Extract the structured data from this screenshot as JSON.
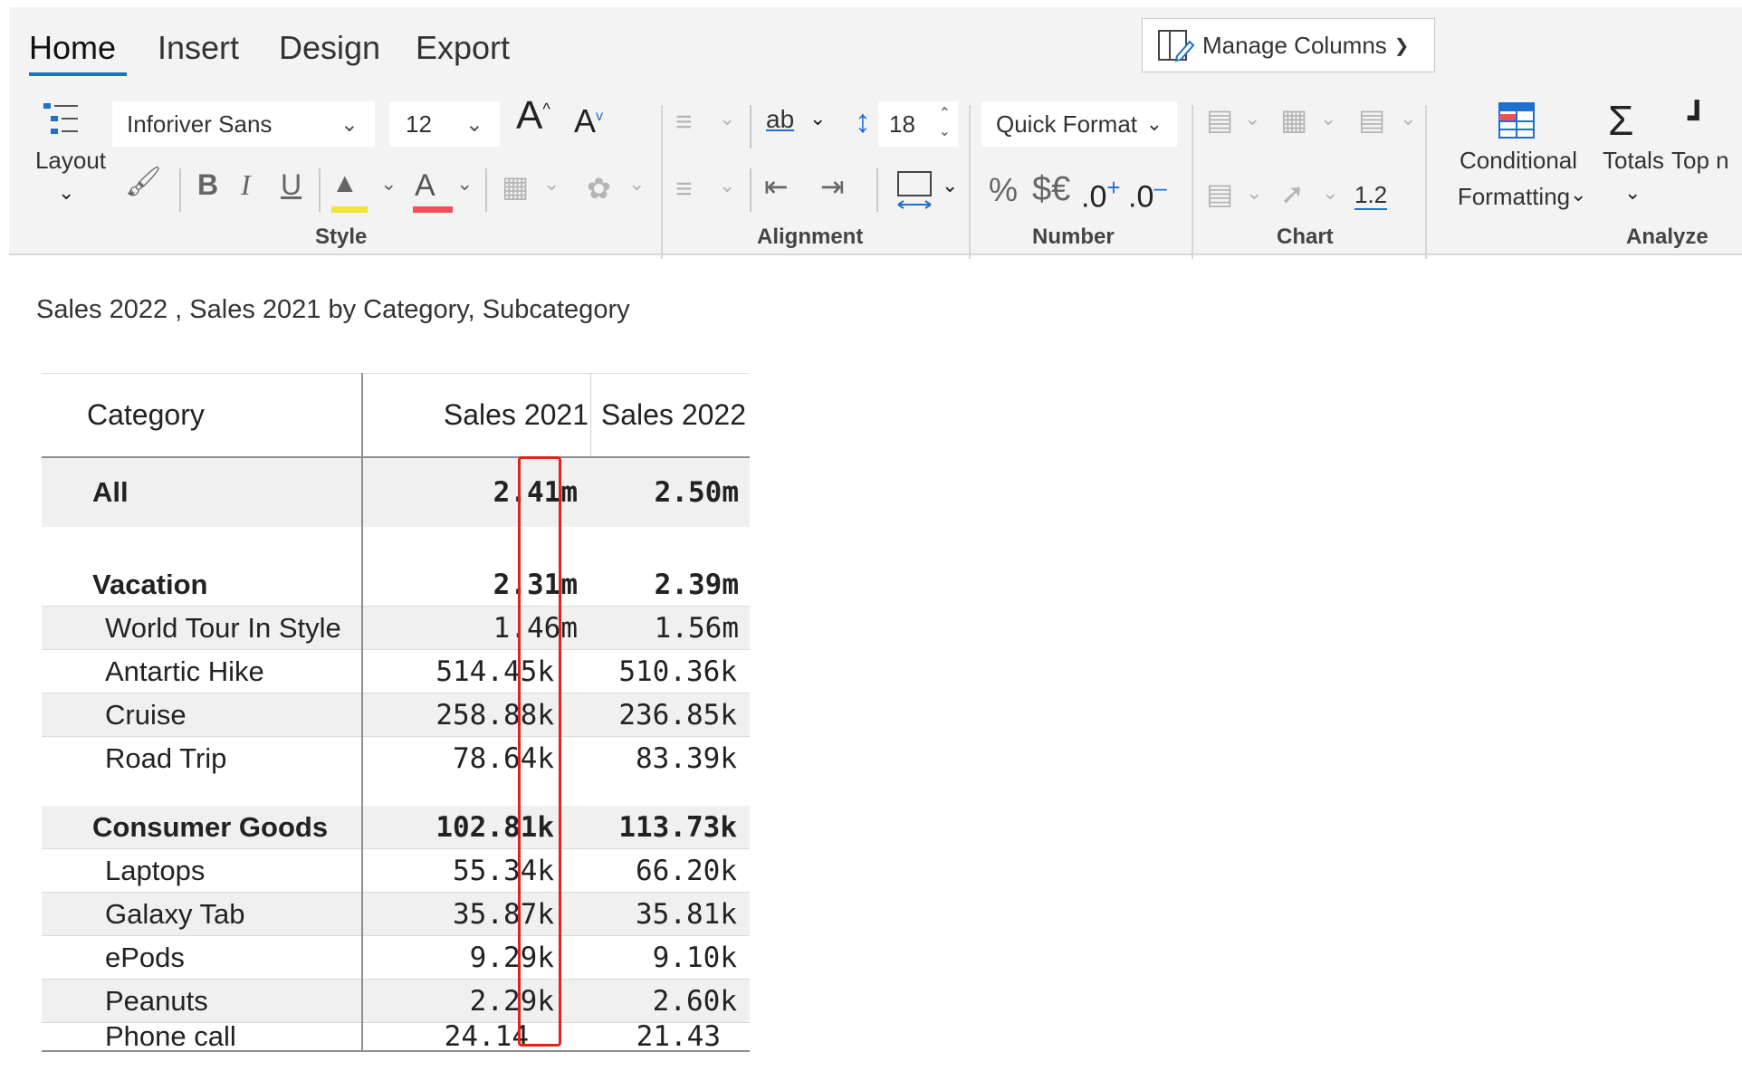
{
  "ribbon": {
    "tabs": [
      "Home",
      "Insert",
      "Design",
      "Export"
    ],
    "active_tab": "Home",
    "manage_columns_label": "Manage Columns",
    "layout_label": "Layout",
    "font_name": "Inforiver Sans",
    "font_size": "12",
    "row_height": "18",
    "quick_format_label": "Quick Format",
    "decimal_value": "1.2",
    "conditional_formatting_line1": "Conditional",
    "conditional_formatting_line2": "Formatting",
    "totals_label": "Totals",
    "top_n_label": "Top n",
    "groups": {
      "style": "Style",
      "alignment": "Alignment",
      "number": "Number",
      "chart": "Chart",
      "analyze": "Analyze"
    },
    "accent_color": "#1f6fce"
  },
  "report": {
    "title": "Sales 2022 , Sales 2021 by Category, Subcategory",
    "columns": {
      "category": "Category",
      "sales_2021": "Sales 2021",
      "sales_2022": "Sales 2022"
    },
    "rows": [
      {
        "label": "All",
        "sales_2021": "2.41m",
        "sales_2022": "2.50m",
        "level": "total"
      },
      {
        "label": "Vacation",
        "sales_2021": "2.31m",
        "sales_2022": "2.39m",
        "level": "group"
      },
      {
        "label": "World Tour In Style",
        "sales_2021": "1.46m",
        "sales_2022": "1.56m",
        "level": "item"
      },
      {
        "label": "Antartic Hike",
        "sales_2021": "514.45k",
        "sales_2022": "510.36k",
        "level": "item"
      },
      {
        "label": "Cruise",
        "sales_2021": "258.88k",
        "sales_2022": "236.85k",
        "level": "item"
      },
      {
        "label": "Road Trip",
        "sales_2021": "78.64k",
        "sales_2022": "83.39k",
        "level": "item"
      },
      {
        "label": "Consumer Goods",
        "sales_2021": "102.81k",
        "sales_2022": "113.73k",
        "level": "group"
      },
      {
        "label": "Laptops",
        "sales_2021": "55.34k",
        "sales_2022": "66.20k",
        "level": "item"
      },
      {
        "label": "Galaxy Tab",
        "sales_2021": "35.87k",
        "sales_2022": "35.81k",
        "level": "item"
      },
      {
        "label": "ePods",
        "sales_2021": "9.29k",
        "sales_2022": "9.10k",
        "level": "item"
      },
      {
        "label": "Peanuts",
        "sales_2021": "2.29k",
        "sales_2022": "2.60k",
        "level": "item"
      },
      {
        "label": "Phone call",
        "sales_2021": "24.14",
        "sales_2022": "21.43",
        "level": "item"
      }
    ],
    "highlight_color": "#e0241c"
  }
}
